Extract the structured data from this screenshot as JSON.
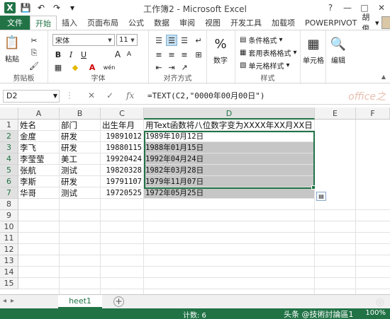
{
  "window": {
    "title": "工作簿2 - Microsoft Excel",
    "controls": [
      "?",
      "—",
      "□",
      "✕"
    ]
  },
  "ribbon_tabs": [
    "文件",
    "开始",
    "插入",
    "页面布局",
    "公式",
    "数据",
    "审阅",
    "视图",
    "开发工具",
    "加载项",
    "POWERPIVOT"
  ],
  "user_name": "胡俊",
  "clipboard": {
    "paste_label": "粘贴",
    "group_label": "剪贴板"
  },
  "font": {
    "name": "宋体",
    "size": "11",
    "group_label": "字体",
    "grow": "A",
    "shrink": "A",
    "bold": "B",
    "italic": "I",
    "underline": "U",
    "ruby": "wén"
  },
  "alignment": {
    "group_label": "对齐方式"
  },
  "number": {
    "label": "数字",
    "percent": "%"
  },
  "styles": {
    "conditional": "条件格式",
    "table": "套用表格格式",
    "cell": "单元格样式",
    "group_label": "样式"
  },
  "cells": {
    "label": "单元格"
  },
  "editing": {
    "label": "编辑"
  },
  "formula_bar": {
    "name_box": "D2",
    "cancel": "✕",
    "enter": "✓",
    "fx": "fx",
    "formula": "=TEXT(C2,\"0000年00月00日\")",
    "watermark": "office之"
  },
  "columns": [
    "A",
    "B",
    "C",
    "D",
    "E",
    "F"
  ],
  "rows": [
    "1",
    "2",
    "3",
    "4",
    "5",
    "6",
    "7",
    "8",
    "9",
    "10",
    "11",
    "12",
    "13",
    "14",
    "15"
  ],
  "table": {
    "header": [
      "姓名",
      "部门",
      "出生年月",
      "用Text函数将八位数字变为XXXX年XX月XX日"
    ],
    "data": [
      [
        "金度",
        "研发",
        "19891012",
        "1989年10月12日"
      ],
      [
        "李飞",
        "研发",
        "19880115",
        "1988年01月15日"
      ],
      [
        "李莹莹",
        "美工",
        "19920424",
        "1992年04月24日"
      ],
      [
        "张航",
        "测试",
        "19820328",
        "1982年03月28日"
      ],
      [
        "李斯",
        "研发",
        "19791107",
        "1979年11月07日"
      ],
      [
        "华哥",
        "测试",
        "19720525",
        "1972年05月25日"
      ]
    ]
  },
  "sheet_tab": "heet1",
  "sheet_add": "+",
  "status": {
    "count": "计数: 6",
    "watermark": "头条 @技術討論區1",
    "zoom": "100%"
  },
  "colors": {
    "accent": "#217346",
    "selection": "#c6c6c6"
  }
}
